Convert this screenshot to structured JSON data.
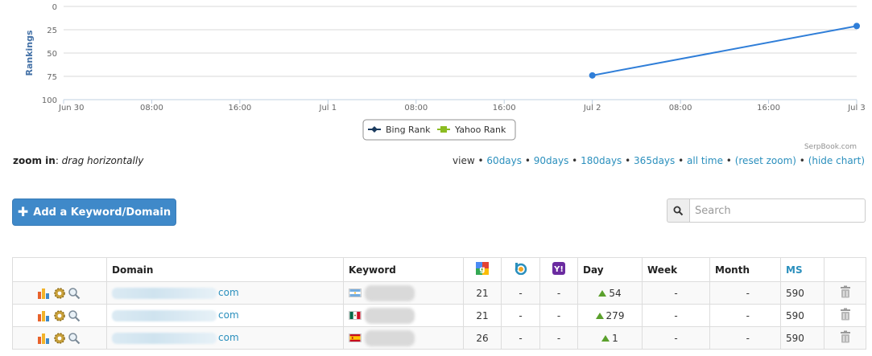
{
  "chart_data": {
    "type": "line",
    "ylabel": "Rankings",
    "ylim": [
      100,
      0
    ],
    "y_ticks": [
      "0",
      "25",
      "50",
      "75",
      "100"
    ],
    "x_ticks": [
      "Jun 30",
      "08:00",
      "16:00",
      "Jul 1",
      "08:00",
      "16:00",
      "Jul 2",
      "08:00",
      "16:00",
      "Jul 3"
    ],
    "series": [
      {
        "name": "Bing Rank",
        "color": "#2f7ed8",
        "points": [
          {
            "x": "Jul 2",
            "y": 74
          },
          {
            "x": "Jul 3",
            "y": 21
          }
        ]
      },
      {
        "name": "Yahoo Rank",
        "color": "#8bbc21",
        "points": []
      }
    ],
    "legend": [
      "Bing Rank",
      "Yahoo Rank"
    ],
    "legend_position": "bottom-center",
    "credit": "SerpBook.com"
  },
  "zoom": {
    "label": "zoom in",
    "hint": "drag horizontally"
  },
  "view": {
    "label": "view",
    "links": [
      "60days",
      "90days",
      "180days",
      "365days",
      "all time",
      "(reset zoom)",
      "(hide chart)"
    ]
  },
  "add_button": {
    "label": "Add a Keyword/Domain",
    "icon": "plus-icon"
  },
  "search": {
    "placeholder": "Search",
    "icon": "search-icon"
  },
  "table": {
    "headers": {
      "domain": "Domain",
      "keyword": "Keyword",
      "google": "google-icon",
      "bing": "bing-icon",
      "yahoo": "yahoo-icon",
      "day": "Day",
      "week": "Week",
      "month": "Month",
      "ms": "MS"
    },
    "rows": [
      {
        "domain": "com",
        "flag": "argentina",
        "google": "21",
        "bing": "-",
        "yahoo": "-",
        "day": "54",
        "week": "-",
        "month": "-",
        "ms": "590"
      },
      {
        "domain": "com",
        "flag": "mexico",
        "google": "21",
        "bing": "-",
        "yahoo": "-",
        "day": "279",
        "week": "-",
        "month": "-",
        "ms": "590"
      },
      {
        "domain": "com",
        "flag": "spain",
        "google": "26",
        "bing": "-",
        "yahoo": "-",
        "day": "1",
        "week": "-",
        "month": "-",
        "ms": "590"
      }
    ]
  }
}
